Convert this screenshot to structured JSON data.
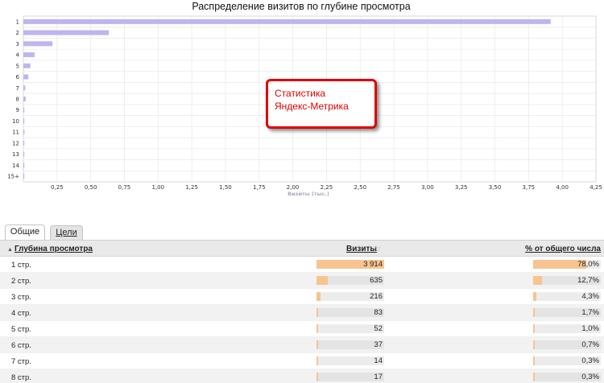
{
  "chart_data": {
    "type": "bar",
    "orientation": "horizontal",
    "title": "Распределение визитов по глубине просмотра",
    "categories": [
      "1",
      "2",
      "3",
      "4",
      "5",
      "6",
      "7",
      "8",
      "9",
      "10",
      "11",
      "12",
      "13",
      "14",
      "15+"
    ],
    "values": [
      3.914,
      0.635,
      0.216,
      0.083,
      0.052,
      0.037,
      0.014,
      0.017,
      0.005,
      0.003,
      0.008,
      0.003,
      0.002,
      0.002,
      0.006
    ],
    "xlabel": "Визиты (тыс.)",
    "xticks": [
      "0,25",
      "0,50",
      "0,75",
      "1,00",
      "1,25",
      "1,50",
      "1,75",
      "2,00",
      "2,25",
      "2,50",
      "2,75",
      "3,00",
      "3,25",
      "3,50",
      "3,75",
      "4,00",
      "4,25"
    ],
    "xlim": [
      0,
      4.25
    ],
    "grid": true,
    "bar_color": "#c0b4f0"
  },
  "callout": {
    "line1": "Статистика",
    "line2": "Яндекс-Метрика",
    "color": "#e00000"
  },
  "tabs": [
    {
      "label": "Общие",
      "active": true
    },
    {
      "label": "Цели",
      "active": false
    }
  ],
  "table": {
    "headers": {
      "depth": "Глубина просмотра",
      "visits": "Визиты",
      "share": "% от общего числа"
    },
    "sort_icon": "sort-ascending-icon",
    "help_icon": "help-icon",
    "rows": [
      {
        "depth": "1 стр.",
        "visits": "3 914",
        "visits_fraction": 1.0,
        "share": "78,0%",
        "share_fraction": 0.78
      },
      {
        "depth": "2 стр.",
        "visits": "635",
        "visits_fraction": 0.162,
        "share": "12,7%",
        "share_fraction": 0.127
      },
      {
        "depth": "3 стр.",
        "visits": "216",
        "visits_fraction": 0.055,
        "share": "4,3%",
        "share_fraction": 0.043
      },
      {
        "depth": "4 стр.",
        "visits": "83",
        "visits_fraction": 0.021,
        "share": "1,7%",
        "share_fraction": 0.017
      },
      {
        "depth": "5 стр.",
        "visits": "52",
        "visits_fraction": 0.013,
        "share": "1,0%",
        "share_fraction": 0.01
      },
      {
        "depth": "6 стр.",
        "visits": "37",
        "visits_fraction": 0.009,
        "share": "0,7%",
        "share_fraction": 0.007
      },
      {
        "depth": "7 стр.",
        "visits": "14",
        "visits_fraction": 0.004,
        "share": "0,3%",
        "share_fraction": 0.003
      },
      {
        "depth": "8 стр.",
        "visits": "17",
        "visits_fraction": 0.004,
        "share": "0,3%",
        "share_fraction": 0.003
      }
    ],
    "bar_color": "#f7c490"
  }
}
